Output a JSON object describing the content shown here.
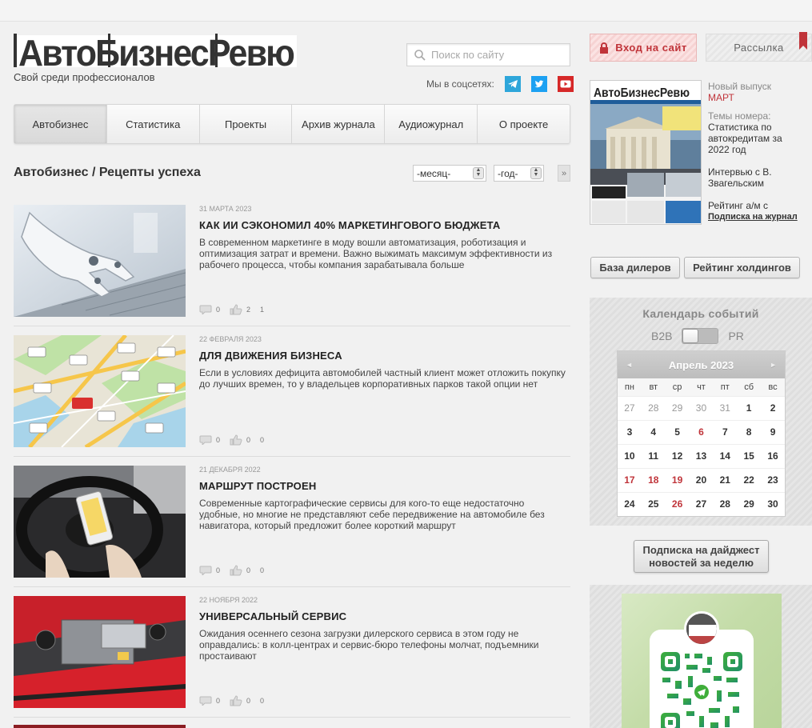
{
  "header": {
    "logo_text": "АвтоБизнесРевю",
    "tagline": "Свой среди профессионалов",
    "search_placeholder": "Поиск по сайту",
    "social_label": "Мы в соцсетях:"
  },
  "nav": {
    "items": [
      {
        "label": "Автобизнес"
      },
      {
        "label": "Статистика"
      },
      {
        "label": "Проекты"
      },
      {
        "label": "Архив журнала"
      },
      {
        "label": "Аудиожурнал"
      },
      {
        "label": "О проекте"
      }
    ]
  },
  "listing": {
    "breadcrumb": "Автобизнес / Рецепты успеха",
    "month_select": "-месяц-",
    "year_select": "-год-",
    "next_symbol": "»"
  },
  "articles": [
    {
      "date": "31 марта 2023",
      "title": "КАК ИИ СЭКОНОМИЛ 40% МАРКЕТИНГОВОГО БЮДЖЕТА",
      "text": "В современном маркетинге в моду вошли автоматизация, роботизация и оптимизация затрат и времени. Важно выжимать максимум эффективности из рабочего процесса, чтобы компания зарабатывала больше",
      "comments": "0",
      "likes": "2",
      "views": "1"
    },
    {
      "date": "22 февраля 2023",
      "title": "ДЛЯ ДВИЖЕНИЯ БИЗНЕСА",
      "text": "Если в условиях дефицита автомобилей частный клиент может отложить покупку до лучших времен, то у владельцев корпоративных парков такой опции нет",
      "comments": "0",
      "likes": "0",
      "views": "0"
    },
    {
      "date": "21 декабря 2022",
      "title": "МАРШРУТ ПОСТРОЕН",
      "text": "Современные картографические сервисы для кого-то еще недостаточно удобные, но многие не представляют себе передвижение на автомобиле без навигатора, который предложит более короткий маршрут",
      "comments": "0",
      "likes": "0",
      "views": "0"
    },
    {
      "date": "22 ноября 2022",
      "title": "УНИВЕРСАЛЬНЫЙ СЕРВИС",
      "text": "Ожидания осеннего сезона загрузки дилерского сервиса в этом году не оправдались: в колл-центрах и сервис-бюро телефоны молчат, подъемники простаивают",
      "comments": "0",
      "likes": "0",
      "views": "0"
    }
  ],
  "sidebar": {
    "login_label": "Вход на сайт",
    "newsletter_label": "Рассылка",
    "issue": {
      "new_issue": "Новый выпуск",
      "month": "МАРТ",
      "topics_label": "Темы номера:",
      "topic1": "Статистика по автокредитам за 2022 год",
      "topic2": "Интервью с В. Звагельским",
      "topic3": "Рейтинг а/м с пробегом",
      "subscribe": "Подписка на журнал"
    },
    "dealers_btn": "База дилеров",
    "holdings_btn": "Рейтинг холдингов",
    "calendar": {
      "title": "Календарь событий",
      "toggle_left": "B2B",
      "toggle_right": "PR",
      "month": "Апрель 2023",
      "prev": "◄",
      "next": "►",
      "weekdays": [
        "пн",
        "вт",
        "ср",
        "чт",
        "пт",
        "сб",
        "вс"
      ],
      "weeks": [
        [
          "27",
          "28",
          "29",
          "30",
          "31",
          "1",
          "2"
        ],
        [
          "3",
          "4",
          "5",
          "6",
          "7",
          "8",
          "9"
        ],
        [
          "10",
          "11",
          "12",
          "13",
          "14",
          "15",
          "16"
        ],
        [
          "17",
          "18",
          "19",
          "20",
          "21",
          "22",
          "23"
        ],
        [
          "24",
          "25",
          "26",
          "27",
          "28",
          "29",
          "30"
        ]
      ]
    },
    "digest_line1": "Подписка на дайджест",
    "digest_line2": "новостей за неделю"
  },
  "colors": {
    "brand_red": "#c0343a",
    "telegram": "#2ea6da",
    "twitter": "#1da1f2",
    "youtube": "#d62828"
  }
}
